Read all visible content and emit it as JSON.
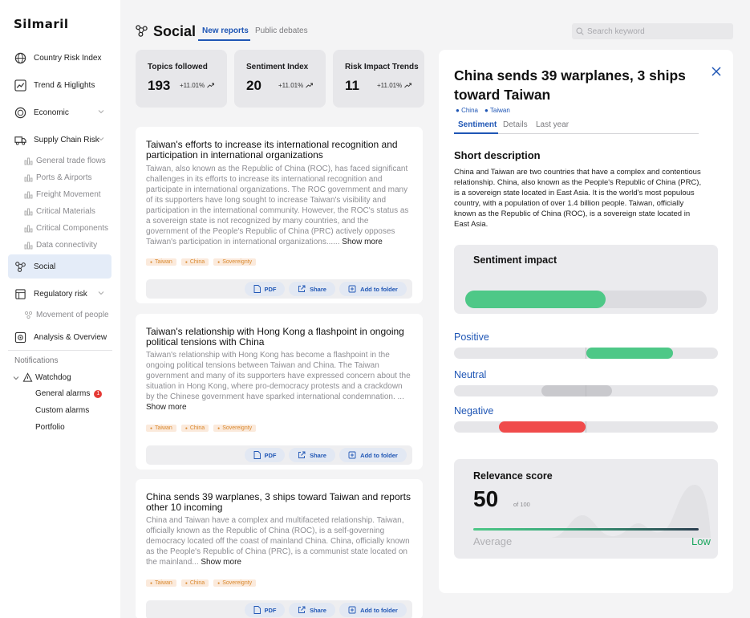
{
  "app": {
    "logo": "Silmaril"
  },
  "sidebar": {
    "items": [
      {
        "label": "Country Risk Index",
        "icon": "globe-icon"
      },
      {
        "label": "Trend & Higlights",
        "icon": "trend-icon"
      },
      {
        "label": "Economic",
        "icon": "coin-icon"
      },
      {
        "label": "Supply Chain Risk",
        "icon": "truck-icon"
      },
      {
        "label": "Social",
        "icon": "network-icon",
        "active": true
      },
      {
        "label": "Regulatory risk",
        "icon": "scale-icon"
      },
      {
        "label": "Analysis & Overview",
        "icon": "analysis-icon"
      }
    ],
    "supply_chain_sub": [
      "General trade flows",
      "Ports & Airports",
      "Freight Movement",
      "Critical Materials",
      "Critical Components",
      "Data connectivity"
    ],
    "regulatory_sub": [
      "Movement of people"
    ],
    "notifications_label": "Notifications",
    "watchdog_label": "Watchdog",
    "alarms": [
      {
        "label": "General alarms",
        "badge": "1"
      },
      {
        "label": "Custom alarms"
      },
      {
        "label": "Portfolio"
      }
    ]
  },
  "header": {
    "title": "Social",
    "tabs": [
      "New reports",
      "Public debates"
    ],
    "search_placeholder": "Search keyword"
  },
  "stats": [
    {
      "label": "Topics followed",
      "value": "193",
      "change": "+11.01%"
    },
    {
      "label": "Sentiment Index",
      "value": "20",
      "change": "+11.01%"
    },
    {
      "label": "Risk Impact Trends",
      "value": "11",
      "change": "+11.01%"
    }
  ],
  "reports": [
    {
      "title": "Taiwan's efforts to increase its international recognition and participation in international organizations",
      "body": "Taiwan, also known as the Republic of China (ROC), has faced significant challenges in its efforts to increase its international recognition and participate in international organizations. The ROC government and many of its supporters have long sought to increase Taiwan's visibility and participation in the international community. However, the ROC's status as a sovereign state is not recognized by many countries, and the government of the People's Republic of China (PRC) actively opposes Taiwan's participation in international organizations......",
      "more": "Show more",
      "tags": [
        "Taiwan",
        "China",
        "Sovereignty"
      ]
    },
    {
      "title": "Taiwan's relationship with Hong Kong a flashpoint in ongoing political tensions with China",
      "body": "Taiwan's relationship with Hong Kong has become a flashpoint in the ongoing political tensions between Taiwan and China. The Taiwan government and many of its supporters have expressed concern about the situation in Hong Kong, where pro-democracy protests and a crackdown by the Chinese government have sparked international condemnation. ...",
      "more": "Show more",
      "tags": [
        "Taiwan",
        "China",
        "Sovereignty"
      ]
    },
    {
      "title": "China sends 39 warplanes, 3 ships toward Taiwan and reports other 10 incoming",
      "body": "China and Taiwan have a complex and multifaceted relationship. Taiwan, officially known as the Republic of China (ROC), is a self-governing democracy located off the coast of mainland China. China, officially known as the People's Republic of China (PRC), is a communist state located on the mainland...",
      "more": "Show more",
      "tags": [
        "Taiwan",
        "China",
        "Sovereignty"
      ]
    }
  ],
  "actions": {
    "pdf": "PDF",
    "share": "Share",
    "folder": "Add to folder"
  },
  "detail": {
    "title": "China sends 39 warplanes, 3 ships toward Taiwan",
    "tags": [
      "China",
      "Taiwan"
    ],
    "tabs": [
      "Sentiment",
      "Details",
      "Last year"
    ],
    "short_heading": "Short description",
    "short_body": "China and Taiwan are two countries that have a complex and contentious relationship. China, also known as the People's Republic of China (PRC), is a sovereign state located in East Asia. It is the world's most populous country, with a population of over 1.4 billion people. Taiwan, officially known as the Republic of China (ROC), is a sovereign state located in East Asia.",
    "impact_heading": "Sentiment impact",
    "impact_fill": 0.58,
    "sentiments": [
      {
        "label": "Positive",
        "color": "#4ec887",
        "from": 0.5,
        "to": 0.83
      },
      {
        "label": "Neutral",
        "color": "#c9c9cd",
        "from": 0.33,
        "to": 0.6
      },
      {
        "label": "Negative",
        "color": "#f04b4b",
        "from": 0.17,
        "to": 0.5
      }
    ],
    "relevance": {
      "heading": "Relevance score",
      "value": "50",
      "of": "of 100",
      "average": "Average",
      "level": "Low"
    }
  },
  "colors": {
    "accent": "#1f56b5",
    "positive": "#4ec887",
    "negative": "#f04b4b",
    "tag": "#d9892f"
  }
}
